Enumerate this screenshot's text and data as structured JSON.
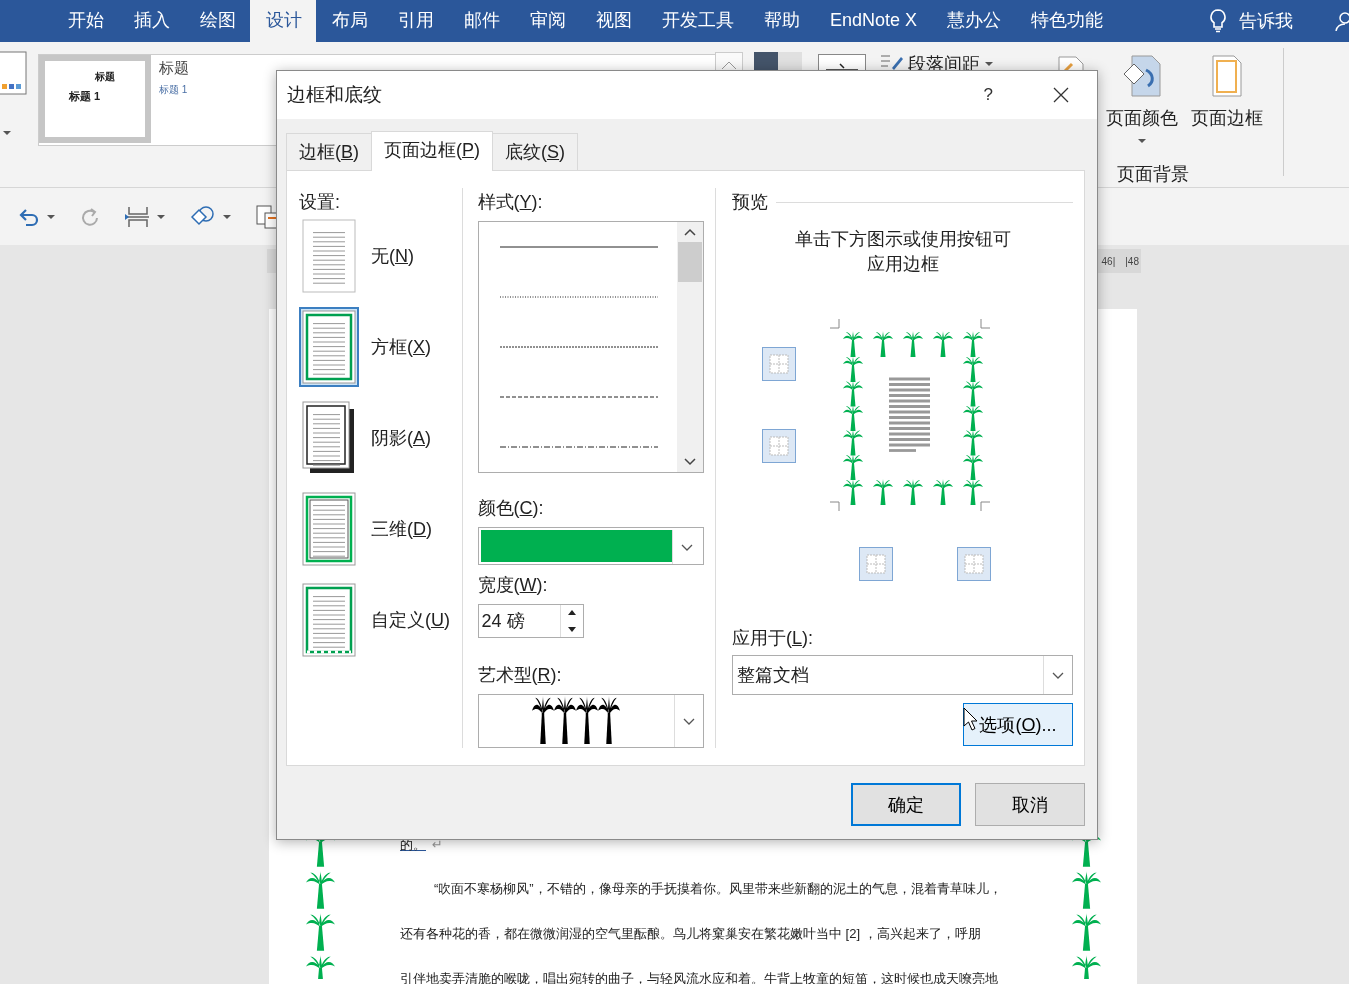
{
  "ribbon_tabs": [
    {
      "label": "开始",
      "selected": false
    },
    {
      "label": "插入",
      "selected": false
    },
    {
      "label": "绘图",
      "selected": false
    },
    {
      "label": "设计",
      "selected": true
    },
    {
      "label": "布局",
      "selected": false
    },
    {
      "label": "引用",
      "selected": false
    },
    {
      "label": "邮件",
      "selected": false
    },
    {
      "label": "审阅",
      "selected": false
    },
    {
      "label": "视图",
      "selected": false
    },
    {
      "label": "开发工具",
      "selected": false
    },
    {
      "label": "帮助",
      "selected": false
    },
    {
      "label": "EndNote X",
      "selected": false
    },
    {
      "label": "慧办公",
      "selected": false
    },
    {
      "label": "特色功能",
      "selected": false
    }
  ],
  "tell_me": "告诉我",
  "ribbon": {
    "gallery": [
      {
        "title": "标题",
        "heading": "标题 1",
        "selected": true
      },
      {
        "title": "标题",
        "heading": "标题 1",
        "selected": false
      }
    ],
    "paragraph_spacing": "段落间距",
    "page_color": "页面颜色",
    "page_borders": "页面边框",
    "group_label": "页面背景"
  },
  "ruler": [
    "46|",
    "|48"
  ],
  "document": {
    "first": "的。",
    "mark": "↵",
    "lines": [
      {
        "text": "“吹面不寒杨柳风”，不错的，像母亲的手抚摸着你。风里带来些新翻的泥土的气息，混着青草味儿，",
        "indent": true
      },
      {
        "text": "还有各种花的香，都在微微润湿的空气里酝酿。鸟儿将窠巢安在繁花嫩叶当中 [2] ，高兴起来了，呼朋",
        "indent": false
      },
      {
        "text": "引伴地卖弄清脆的喉咙，唱出宛转的曲子，与轻风流水应和着。牛背上牧童的短笛，这时候也成天嘹亮地",
        "indent": false
      }
    ]
  },
  "dialog": {
    "title": "边框和底纹",
    "help": "?",
    "tabs": [
      {
        "pre": "边框(",
        "key": "B",
        "post": ")",
        "selected": false
      },
      {
        "pre": "页面边框(",
        "key": "P",
        "post": ")",
        "selected": true
      },
      {
        "pre": "底纹(",
        "key": "S",
        "post": ")",
        "selected": false
      }
    ],
    "settings": {
      "label": {
        "pre": "设置:"
      },
      "items": [
        {
          "kind": "none",
          "pre": "无(",
          "key": "N",
          "post": ")",
          "selected": false
        },
        {
          "kind": "box",
          "pre": "方框(",
          "key": "X",
          "post": ")",
          "selected": true
        },
        {
          "kind": "shadow",
          "pre": "阴影(",
          "key": "A",
          "post": ")",
          "selected": false
        },
        {
          "kind": "threed",
          "pre": "三维(",
          "key": "D",
          "post": ")",
          "selected": false
        },
        {
          "kind": "custom",
          "pre": "自定义(",
          "key": "U",
          "post": ")",
          "selected": false
        }
      ]
    },
    "style": {
      "label": {
        "pre": "样式(",
        "key": "Y",
        "post": "):"
      },
      "items": [
        {
          "kind": "solid"
        },
        {
          "kind": "dotted"
        },
        {
          "kind": "fine-dash"
        },
        {
          "kind": "dashed"
        },
        {
          "kind": "dash-dot"
        }
      ]
    },
    "color": {
      "label": {
        "pre": "颜色(",
        "key": "C",
        "post": "):"
      },
      "color": "#00b050"
    },
    "width": {
      "label": {
        "pre": "宽度(",
        "key": "W",
        "post": "):"
      },
      "value": "24 磅"
    },
    "art": {
      "label": {
        "pre": "艺术型(",
        "key": "R",
        "post": "):"
      }
    },
    "preview": {
      "label": "预览",
      "hint_lines": [
        "单击下方图示或使用按钮可",
        "应用边框"
      ]
    },
    "apply_to": {
      "label": {
        "pre": "应用于(",
        "key": "L",
        "post": "):"
      },
      "value": "整篇文档"
    },
    "options_button": {
      "pre": "选项(",
      "key": "O",
      "post": ")...",
      "hovered": true
    },
    "ok": "确定",
    "cancel": "取消"
  }
}
